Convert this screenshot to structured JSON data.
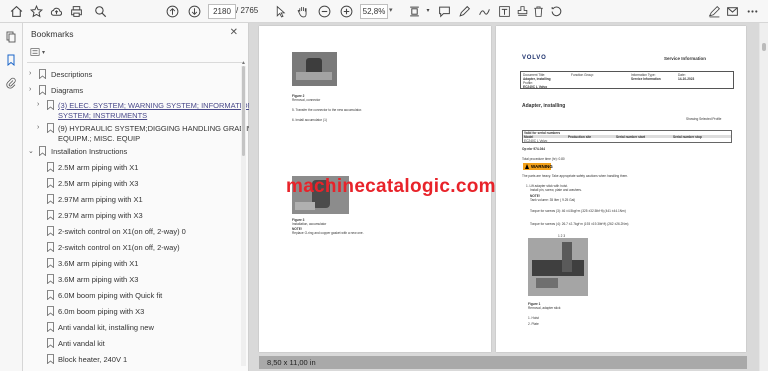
{
  "toolbar": {
    "current_page": "2180",
    "total_pages": "/ 2765",
    "zoom": "52,8%"
  },
  "panel": {
    "title": "Bookmarks",
    "bookmarks": [
      {
        "label": "Descriptions",
        "expandable": true,
        "link": false
      },
      {
        "label": "Diagrams",
        "expandable": true,
        "link": false
      },
      {
        "label": "(3) ELEC. SYSTEM; WARNING SYSTEM; INFORMATION",
        "label2": "SYSTEM; INSTRUMENTS",
        "expandable": true,
        "link": true
      },
      {
        "label": "(9) HYDRAULIC SYSTEM;DIGGING HANDLING GRADING",
        "label2": "EQUIPM.; MISC. EQUIP",
        "expandable": true,
        "link": false
      },
      {
        "label": "Installation Instructions",
        "expandable": true,
        "expanded": true,
        "link": false
      },
      {
        "label": "2.5M arm piping with X1"
      },
      {
        "label": "2.5M arm piping with X3"
      },
      {
        "label": "2.97M arm piping with X1"
      },
      {
        "label": "2.97M arm piping with X3"
      },
      {
        "label": "2-switch control on X1(on off, 2-way) 0"
      },
      {
        "label": "2-switch control on X1(on off, 2-way)"
      },
      {
        "label": "3.6M arm piping with X1"
      },
      {
        "label": "3.6M arm piping with X3"
      },
      {
        "label": "6.0M boom piping with Quick fit"
      },
      {
        "label": "6.0m boom piping with X3"
      },
      {
        "label": "Anti vandal kit, installing new"
      },
      {
        "label": "Anti vandal kit"
      },
      {
        "label": "Block heater, 240V 1"
      }
    ]
  },
  "status": {
    "page_size": "8,50 x 11,00 in"
  },
  "watermark": "machinecatalogic.com",
  "left_page": {
    "fig2_title": "Figure 2",
    "fig2_caption": "Removal, connector",
    "step5": "5.   Transfer the connector to the new accumulator.",
    "step6": "6.   Install accumulator (1)",
    "fig3_title": "Figure 3",
    "fig3_caption": "Installation, accumulator",
    "note_label": "NOTE!",
    "note_text": "Replace O-ring and copper gasket with a new one."
  },
  "right_page": {
    "brand": "VOLVO",
    "header_title": "Service Information",
    "doc_title_label": "Document Title:",
    "doc_title": "Adapter, installing",
    "function_group_label": "Function Group:",
    "info_type_label": "Information Type:",
    "info_type": "Service Information",
    "date_label": "Date:",
    "date": "14-10-2023",
    "profile_label": "Profile:",
    "profile": "EC240C L Volvo",
    "heading": "Adapter, installing",
    "showing_profile": "Showing Selected Profile",
    "table_valid": "Valid for serial numbers",
    "table_model": "Model",
    "table_production_site": "Production site",
    "table_serial_start": "Serial number start",
    "table_serial_stop": "Serial number stop",
    "table_model_value": "EC240C L Volvo",
    "op_no": "Op nbr 974-044",
    "total_time": "Total procedure time (hr): 0.80",
    "warning_label": "WARNING",
    "warning_text": "The parts are heavy. Take appropriate safety cautions when handling them.",
    "step1": "1.   Lift adapter stick with hoist.",
    "step1b": "Install pin, screw, plate and washers.",
    "note_label": "NOTE!",
    "tank_vol": "Tank volume: 35 liter ( 9.25 Gal)",
    "torque1": "Torque for screws (3): 46 ±4.5kgf·m (325 ±32.5lbf·ft) (441 ±44.1Nm)",
    "torque2": "Torque for screws (4): 26.7 ±2.7kgf·m (193 ±19.3lbf·ft) (262 ±26.2Nm)",
    "fig1_title": "Figure 1",
    "fig1_caption": "Removal, adapter stick",
    "item1": "1.       Hoist",
    "item2": "2.       Plate",
    "callouts": "1   2   3"
  }
}
